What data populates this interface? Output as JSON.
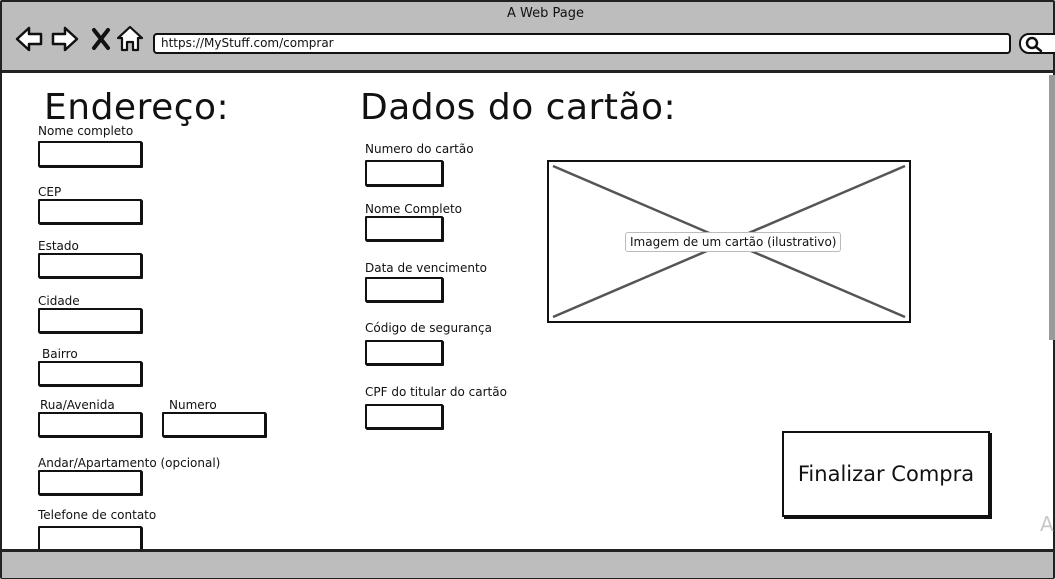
{
  "window": {
    "title": "A Web Page"
  },
  "browser": {
    "url": "https://MyStuff.com/comprar",
    "nav_icons": [
      "back-arrow-icon",
      "forward-arrow-icon",
      "close-icon",
      "home-icon",
      "search-icon"
    ]
  },
  "address_section": {
    "heading": "Endereço:",
    "fields": {
      "full_name": "Nome completo",
      "cep": "CEP",
      "state": "Estado",
      "city": "Cidade",
      "neighborhood": "Bairro",
      "street": "Rua/Avenida",
      "number": "Numero",
      "floor_apartment": "Andar/Apartamento (opcional)",
      "phone": "Telefone de contato"
    }
  },
  "card_section": {
    "heading": "Dados do cartão:",
    "fields": {
      "card_number": "Numero do cartão",
      "full_name": "Nome Completo",
      "expiry": "Data de vencimento",
      "security_code": "Código de segurança",
      "cpf": "CPF do titular do cartão"
    },
    "image_caption": "Imagem de um cartão (ilustrativo)"
  },
  "actions": {
    "submit_label": "Finalizar Compra"
  },
  "watermark": "A"
}
